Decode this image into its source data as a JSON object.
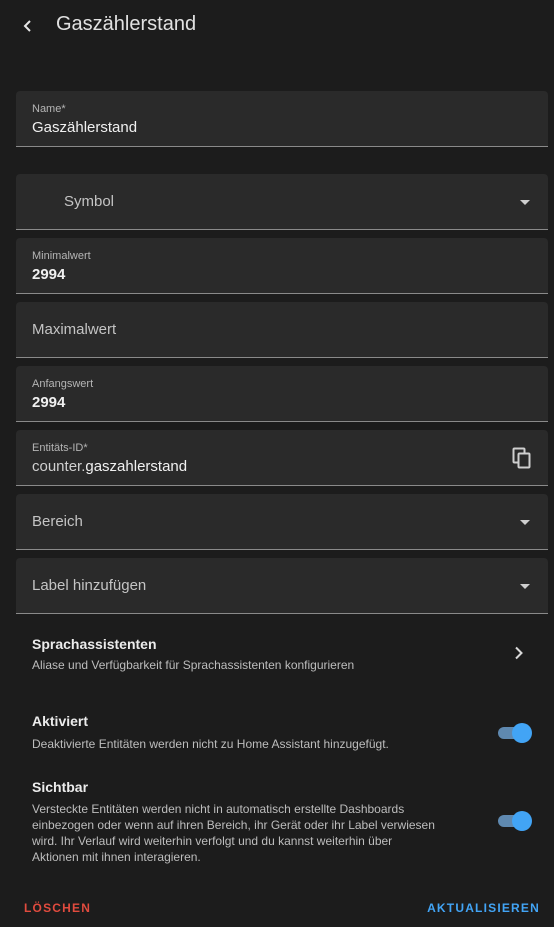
{
  "header": {
    "title": "Gaszählerstand"
  },
  "fields": {
    "name": {
      "label": "Name*",
      "value": "Gaszählerstand"
    },
    "symbol": {
      "placeholder": "Symbol"
    },
    "minimum": {
      "label": "Minimalwert",
      "value": "2994"
    },
    "maximum": {
      "placeholder": "Maximalwert"
    },
    "initial": {
      "label": "Anfangswert",
      "value": "2994"
    },
    "entity_id": {
      "label": "Entitäts-ID*",
      "prefix": "counter.",
      "value": "gaszahlerstand"
    },
    "area": {
      "placeholder": "Bereich"
    },
    "labels": {
      "placeholder": "Label hinzufügen"
    }
  },
  "voice": {
    "title": "Sprachassistenten",
    "description": "Aliase und Verfügbarkeit für Sprachassistenten konfigurieren"
  },
  "enabled": {
    "title": "Aktiviert",
    "description": "Deaktivierte Entitäten werden nicht zu Home Assistant hinzugefügt.",
    "on": true
  },
  "visible": {
    "title": "Sichtbar",
    "description_lines": [
      "Versteckte Entitäten werden nicht in automatisch erstellte Dashboards",
      "einbezogen oder wenn auf ihren Bereich, ihr Gerät oder ihr Label verwiesen",
      "wird. Ihr Verlauf wird weiterhin verfolgt und du kannst weiterhin über",
      "Aktionen mit ihnen interagieren."
    ],
    "on": true
  },
  "actions": {
    "delete": "LÖSCHEN",
    "update": "AKTUALISIEREN"
  },
  "colors": {
    "accent": "#42a4f5",
    "danger": "#e14b3e",
    "background": "#1c1c1c",
    "field": "#2a2a2a"
  }
}
